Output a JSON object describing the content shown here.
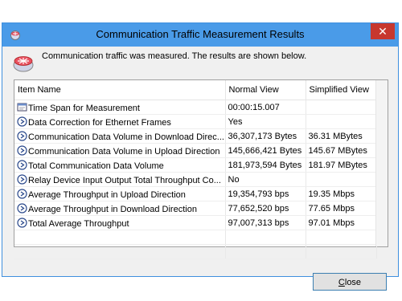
{
  "window": {
    "title": "Communication Traffic Measurement Results",
    "close_glyph": "✕"
  },
  "message": "Communication traffic was measured. The results are shown below.",
  "table": {
    "headers": [
      "Item Name",
      "Normal View",
      "Simplified View"
    ],
    "rows": [
      {
        "icon": "clock-icon",
        "name": "Time Span for Measurement",
        "normal": "00:00:15.007",
        "simple": ""
      },
      {
        "icon": "info-arrow-icon",
        "name": "Data Correction for Ethernet Frames",
        "normal": "Yes",
        "simple": ""
      },
      {
        "icon": "info-arrow-icon",
        "name": "Communication Data Volume in Download Direc...",
        "normal": "36,307,173 Bytes",
        "simple": "36.31 MBytes"
      },
      {
        "icon": "info-arrow-icon",
        "name": "Communication Data Volume in Upload Direction",
        "normal": "145,666,421 Bytes",
        "simple": "145.67 MBytes"
      },
      {
        "icon": "info-arrow-icon",
        "name": "Total Communication Data Volume",
        "normal": "181,973,594 Bytes",
        "simple": "181.97 MBytes"
      },
      {
        "icon": "info-arrow-icon",
        "name": "Relay Device Input Output Total Throughput Co...",
        "normal": "No",
        "simple": ""
      },
      {
        "icon": "info-arrow-icon",
        "name": "Average Throughput in Upload Direction",
        "normal": "19,354,793 bps",
        "simple": "19.35 Mbps"
      },
      {
        "icon": "info-arrow-icon",
        "name": "Average Throughput in Download Direction",
        "normal": "77,652,520 bps",
        "simple": "77.65 Mbps"
      },
      {
        "icon": "info-arrow-icon",
        "name": "Total Average Throughput",
        "normal": "97,007,313 bps",
        "simple": "97.01 Mbps"
      }
    ],
    "empty_rows": 2
  },
  "buttons": {
    "close_mnemonic": "C",
    "close_rest": "lose"
  },
  "colors": {
    "titlebar": "#4a9be8",
    "close_button": "#c7372e",
    "focus_border": "#3c7fb1"
  }
}
